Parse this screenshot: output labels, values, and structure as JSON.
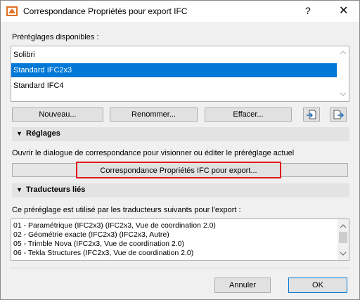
{
  "window": {
    "title": "Correspondance Propriétés pour export IFC",
    "help": "?",
    "close": "✕"
  },
  "presets": {
    "label": "Préréglages disponibles :",
    "items": [
      "Solibri",
      "Standard IFC2x3",
      "Standard IFC4"
    ],
    "selected_index": 1
  },
  "preset_buttons": {
    "new": "Nouveau...",
    "rename": "Renommer...",
    "delete": "Effacer..."
  },
  "settings": {
    "header": "Réglages",
    "description": "Ouvrir le dialogue de correspondance pour visionner ou éditer le préréglage actuel",
    "mapping_button": "Correspondance Propriétés IFC pour export..."
  },
  "translators": {
    "header": "Traducteurs liés",
    "description": "Ce préréglage est utilisé par les traducteurs suivants pour l'export :",
    "items": [
      "01 - Paramétrique (IFC2x3) (IFC2x3, Vue de coordination 2.0)",
      "02 - Géométrie exacte (IFC2x3) (IFC2x3, Autre)",
      "05 - Trimble Nova (IFC2x3, Vue de coordination 2.0)",
      "06 - Tekla Structures (IFC2x3, Vue de coordination 2.0)"
    ]
  },
  "footer": {
    "cancel": "Annuler",
    "ok": "OK"
  }
}
